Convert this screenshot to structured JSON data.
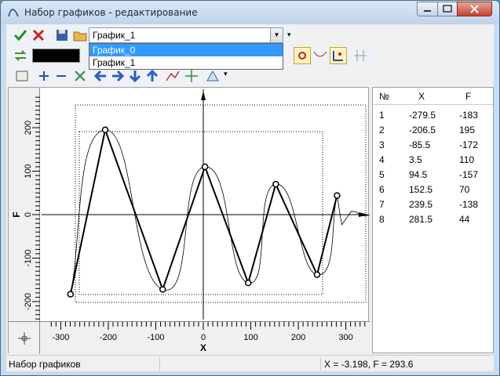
{
  "window": {
    "title": "Набор графиков - редактирование"
  },
  "graph_selector": {
    "value": "График_1",
    "options": [
      "График_0",
      "График_1"
    ],
    "highlighted": "График_0"
  },
  "plot": {
    "xlabel": "X",
    "ylabel": "F",
    "xticks": [
      "-300",
      "-200",
      "-100",
      "0",
      "100",
      "200",
      "300"
    ],
    "yticks": [
      "200",
      "100",
      "0",
      "-100",
      "-200"
    ]
  },
  "table": {
    "headers": [
      "№",
      "X",
      "F"
    ],
    "rows": [
      [
        "1",
        "-279.5",
        "-183"
      ],
      [
        "2",
        "-206.5",
        "195"
      ],
      [
        "3",
        "-85.5",
        "-172"
      ],
      [
        "4",
        "3.5",
        "110"
      ],
      [
        "5",
        "94.5",
        "-157"
      ],
      [
        "6",
        "152.5",
        "70"
      ],
      [
        "7",
        "239.5",
        "-138"
      ],
      [
        "8",
        "281.5",
        "44"
      ]
    ]
  },
  "status": {
    "left": "Набор графиков",
    "right": "X = -3.198, F = 293.6"
  },
  "chart_data": {
    "type": "line",
    "x": [
      -279.5,
      -206.5,
      -85.5,
      3.5,
      94.5,
      152.5,
      239.5,
      281.5
    ],
    "series": [
      {
        "values": [
          -183,
          195,
          -172,
          110,
          -157,
          70,
          -138,
          44
        ]
      }
    ],
    "xlabel": "X",
    "ylabel": "F",
    "xlim": [
      -320,
      340
    ],
    "ylim": [
      -240,
      270
    ]
  }
}
